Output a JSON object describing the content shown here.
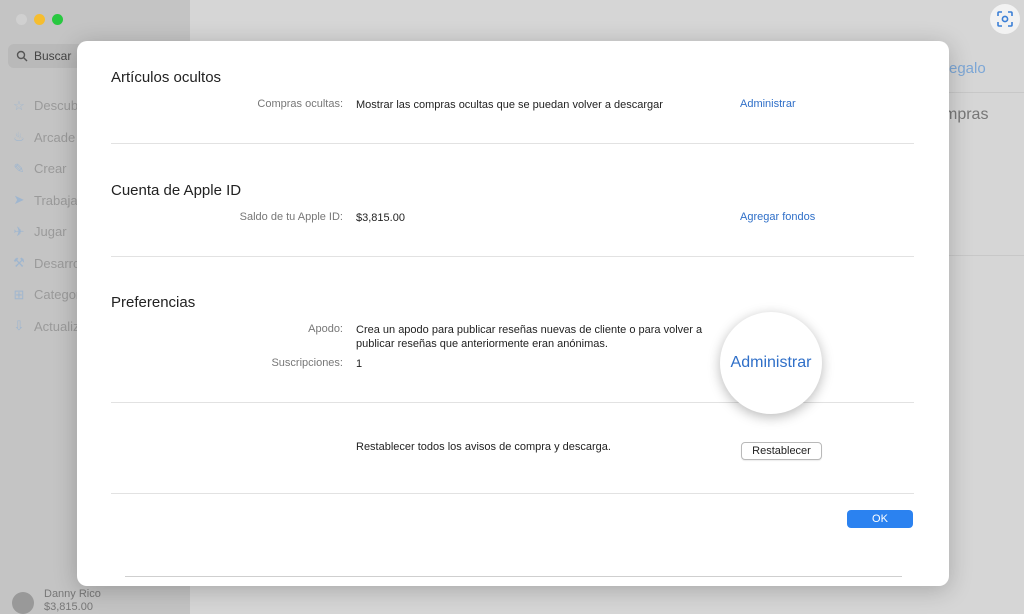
{
  "app": {
    "search_placeholder": "Buscar",
    "sidebar_items": [
      {
        "label": "Descubrir",
        "icon": "star-icon"
      },
      {
        "label": "Arcade",
        "icon": "joystick-icon"
      },
      {
        "label": "Crear",
        "icon": "brush-icon"
      },
      {
        "label": "Trabajar",
        "icon": "paper-plane-icon"
      },
      {
        "label": "Jugar",
        "icon": "rocket-icon"
      },
      {
        "label": "Desarrollar",
        "icon": "hammer-icon"
      },
      {
        "label": "Categorías",
        "icon": "grid-icon"
      },
      {
        "label": "Actualizaciones",
        "icon": "download-icon"
      }
    ],
    "account_name": "Danny Rico",
    "account_balance": "$3,815.00",
    "gift_link": "regalo",
    "purchases_heading": "mpras"
  },
  "modal": {
    "hidden_items": {
      "title": "Artículos ocultos",
      "label": "Compras ocultas:",
      "value": "Mostrar las compras ocultas que se puedan volver a descargar",
      "link": "Administrar"
    },
    "apple_id": {
      "title": "Cuenta de Apple ID",
      "label": "Saldo de tu Apple ID:",
      "value": "$3,815.00",
      "link": "Agregar fondos"
    },
    "preferences": {
      "title": "Preferencias",
      "nickname_label": "Apodo:",
      "nickname_value_line1": "Crea un apodo para publicar reseñas nuevas de cliente o para volver a",
      "nickname_value_line2": "publicar reseñas que anteriormente eran anónimas.",
      "subscriptions_label": "Suscripciones:",
      "subscriptions_value": "1",
      "manage_link": "Administrar"
    },
    "reset": {
      "text": "Restablecer todos los avisos de compra y descarga.",
      "button": "Restablecer"
    },
    "ok_button": "OK"
  },
  "colors": {
    "link": "#2f6fc8",
    "primary_button": "#2b82f0"
  }
}
